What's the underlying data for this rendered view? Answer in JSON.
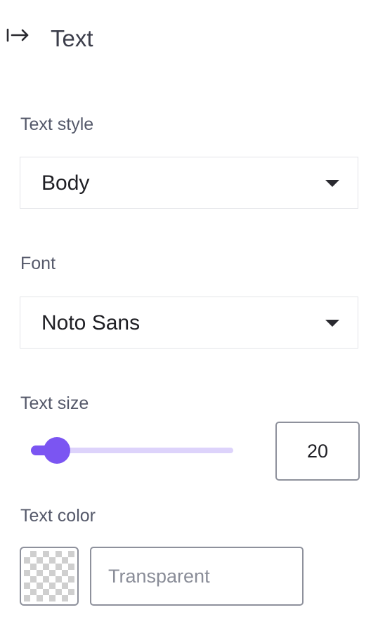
{
  "header": {
    "collapse_icon": "arrow-right-to-bar-icon",
    "title": "Text"
  },
  "text_style": {
    "label": "Text style",
    "value": "Body"
  },
  "font": {
    "label": "Font",
    "value": "Noto Sans"
  },
  "text_size": {
    "label": "Text size",
    "value": "20",
    "slider_fraction": 0.13
  },
  "text_color": {
    "label": "Text color",
    "swatch_icon": "transparent-checkerboard-icon",
    "value": "",
    "placeholder": "Transparent"
  },
  "colors": {
    "accent": "#7b55f2",
    "track": "#ddd3fb",
    "text": "#3b3d4a",
    "label": "#55596a",
    "border": "#8e919c"
  }
}
